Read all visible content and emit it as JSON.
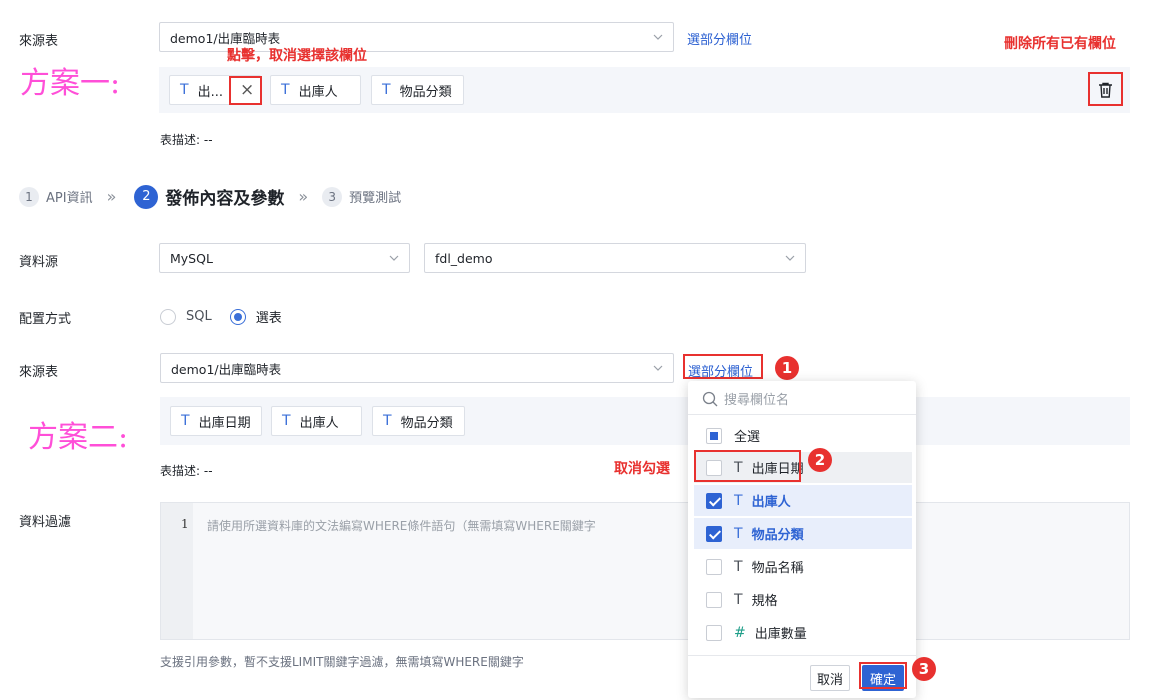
{
  "plan1": {
    "label": "方案一:",
    "source_table_label": "來源表",
    "source_table_value": "demo1/出庫臨時表",
    "select_fields_link": "選部分欄位",
    "chips": [
      {
        "icon": "T",
        "label": "出..."
      },
      {
        "icon": "T",
        "label": "出庫人"
      },
      {
        "icon": "T",
        "label": "物品分類"
      }
    ],
    "chip_remove_icon": "×",
    "table_desc": "表描述: --",
    "note_click": "點擊，取消選擇該欄位",
    "note_delete_all": "刪除所有已有欄位"
  },
  "steps": [
    {
      "num": "1",
      "label": "API資訊"
    },
    {
      "num": "2",
      "label": "發佈內容及參數"
    },
    {
      "num": "3",
      "label": "預覽測試"
    }
  ],
  "form": {
    "datasource_label": "資料源",
    "datasource_value": "MySQL",
    "database_value": "fdl_demo",
    "config_label": "配置方式",
    "config_options": [
      "SQL",
      "選表"
    ],
    "source_table_label": "來源表",
    "source_table_value": "demo1/出庫臨時表",
    "select_fields_link": "選部分欄位",
    "table_desc": "表描述: --",
    "filter_label": "資料過濾",
    "editor_line_no": "1",
    "editor_placeholder": "請使用所選資料庫的文法編寫WHERE條件語句（無需填寫WHERE關鍵字",
    "hint": "支援引用參數，暫不支援LIMIT關鍵字過濾，無需填寫WHERE關鍵字"
  },
  "plan2": {
    "label": "方案二:",
    "chips": [
      {
        "icon": "T",
        "label": "出庫日期"
      },
      {
        "icon": "T",
        "label": "出庫人"
      },
      {
        "icon": "T",
        "label": "物品分類"
      }
    ],
    "note_uncheck": "取消勾選"
  },
  "dropdown": {
    "search_placeholder": "搜尋欄位名",
    "select_all": "全選",
    "items": [
      {
        "icon": "T",
        "label": "出庫日期",
        "checked": false
      },
      {
        "icon": "T",
        "label": "出庫人",
        "checked": true
      },
      {
        "icon": "T",
        "label": "物品分類",
        "checked": true
      },
      {
        "icon": "T",
        "label": "物品名稱",
        "checked": false
      },
      {
        "icon": "T",
        "label": "規格",
        "checked": false
      },
      {
        "icon": "#",
        "label": "出庫數量",
        "checked": false
      }
    ],
    "cancel": "取消",
    "confirm": "確定"
  },
  "badges": [
    "1",
    "2",
    "3"
  ],
  "colors": {
    "accent": "#2e63d3",
    "annotation": "#e8312f",
    "plan_label": "#ff4fd8"
  }
}
